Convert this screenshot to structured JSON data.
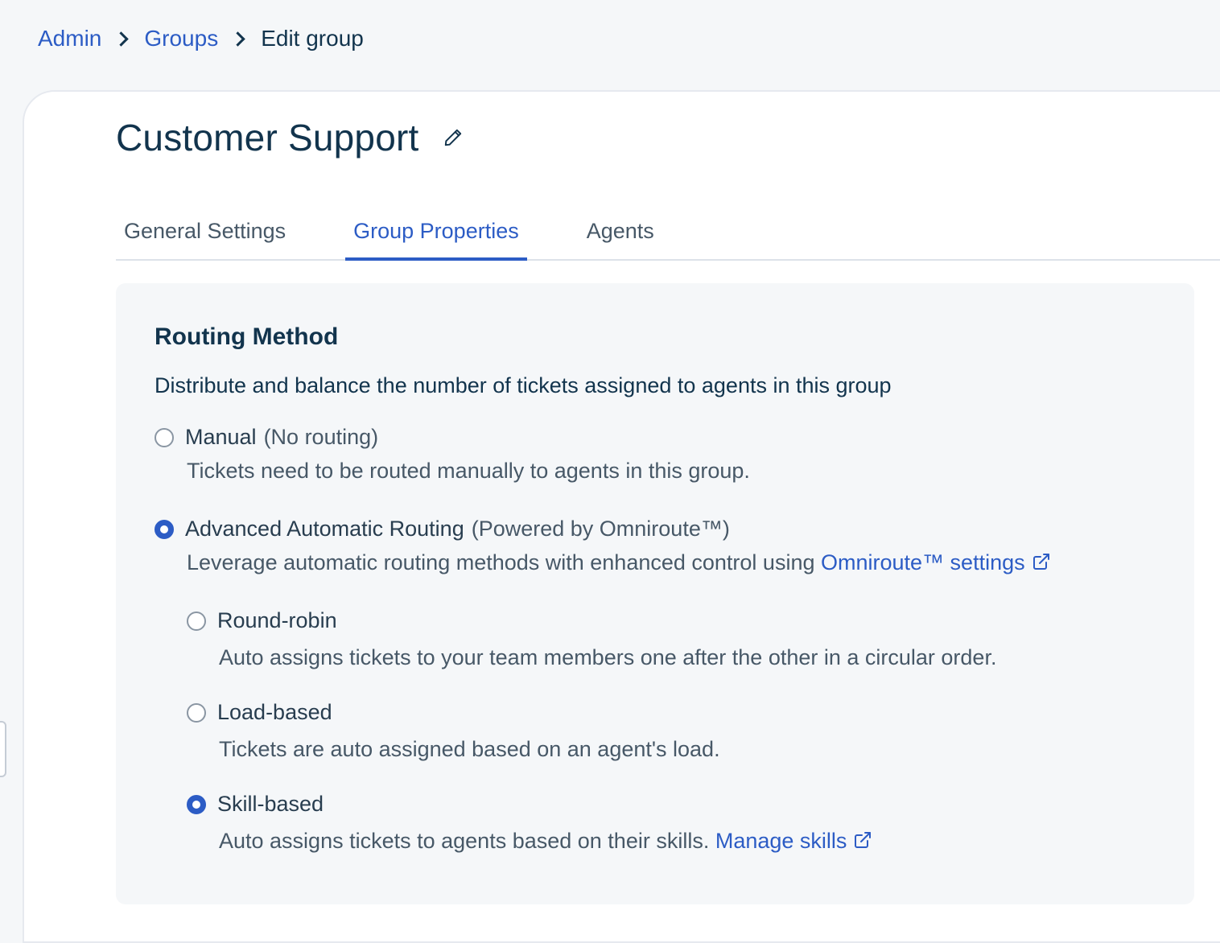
{
  "breadcrumb": {
    "admin": "Admin",
    "groups": "Groups",
    "current": "Edit group"
  },
  "page": {
    "title": "Customer Support"
  },
  "tabs": [
    {
      "label": "General Settings",
      "active": false
    },
    {
      "label": "Group Properties",
      "active": true
    },
    {
      "label": "Agents",
      "active": false
    }
  ],
  "routing": {
    "title": "Routing Method",
    "description": "Distribute and balance the number of tickets assigned to agents in this group",
    "manual": {
      "label": "Manual",
      "suffix": "(No routing)",
      "description": "Tickets need to be routed manually to agents in this group.",
      "selected": false
    },
    "advanced": {
      "label": "Advanced Automatic Routing",
      "suffix": "(Powered by Omniroute™)",
      "description": "Leverage automatic routing methods with enhanced control using",
      "link": "Omniroute™ settings",
      "selected": true
    },
    "round_robin": {
      "label": "Round-robin",
      "description": "Auto assigns tickets to your team members one after the other in a circular order.",
      "selected": false
    },
    "load_based": {
      "label": "Load-based",
      "description": "Tickets are auto assigned based on an agent's load.",
      "selected": false
    },
    "skill_based": {
      "label": "Skill-based",
      "description": "Auto assigns tickets to agents based on their skills.",
      "link": "Manage skills",
      "selected": true
    }
  },
  "colors": {
    "accent": "#2c5cc5",
    "text": "#12344d",
    "muted": "#475867",
    "background": "#f5f7f9"
  }
}
